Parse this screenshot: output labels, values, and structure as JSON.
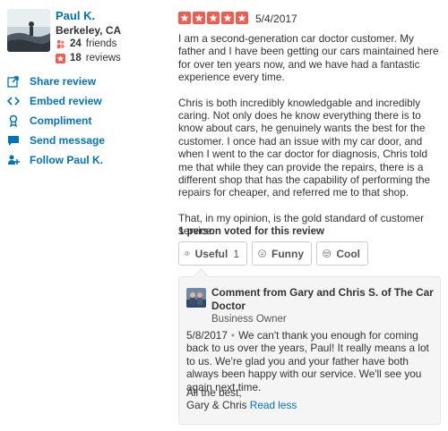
{
  "user": {
    "name": "Paul K.",
    "location": "Berkeley, CA",
    "friends_count": "24",
    "friends_label": "friends",
    "reviews_count": "18",
    "reviews_label": "reviews"
  },
  "actions": [
    {
      "label": "Share review",
      "icon": "share-icon"
    },
    {
      "label": "Embed review",
      "icon": "embed-icon"
    },
    {
      "label": "Compliment",
      "icon": "compliment-icon"
    },
    {
      "label": "Send message",
      "icon": "message-icon"
    },
    {
      "label": "Follow Paul K.",
      "icon": "follow-icon"
    }
  ],
  "review": {
    "rating": 5,
    "rating_max": 5,
    "date": "5/4/2017",
    "paragraphs": [
      "I am a second-generation car doctor customer. My father and I have been getting our cars maintained here for over ten years now, and we have had a fantastic experience every time.",
      "Chris is both incredibly knowledgable and incredibly caring. Not only does he know everything there is to know about cars, he genuinely wants the best for the customer. I once had an issue with my car door, and when I went to the car doctor for diagnosis, Chris told me that while they can provide the repairs, there is a different shop that has the capability of performing the repairs for cheaper, and referred me to that shop.",
      "That, in my opinion, is the gold standard of customer service."
    ],
    "colors": {
      "star": "#f15c4f",
      "link": "#0073bb"
    }
  },
  "votes": {
    "label": "1 person voted for this review",
    "useful_label": "Useful",
    "useful_count": "1",
    "funny_label": "Funny",
    "cool_label": "Cool"
  },
  "owner_comment": {
    "title": "Comment from Gary and Chris S. of The Car Doctor",
    "role": "Business Owner",
    "date": "5/8/2017",
    "separator": "•",
    "text": "We can't thank you enough for coming back to us over the years, Paul! It really means a lot to us. We're glad you and your father have both always been happy with our service. We'll see you again next time.",
    "signoff_line1": "All the best,",
    "signoff_line2": "Gary & Chris",
    "read_less": "Read less"
  }
}
